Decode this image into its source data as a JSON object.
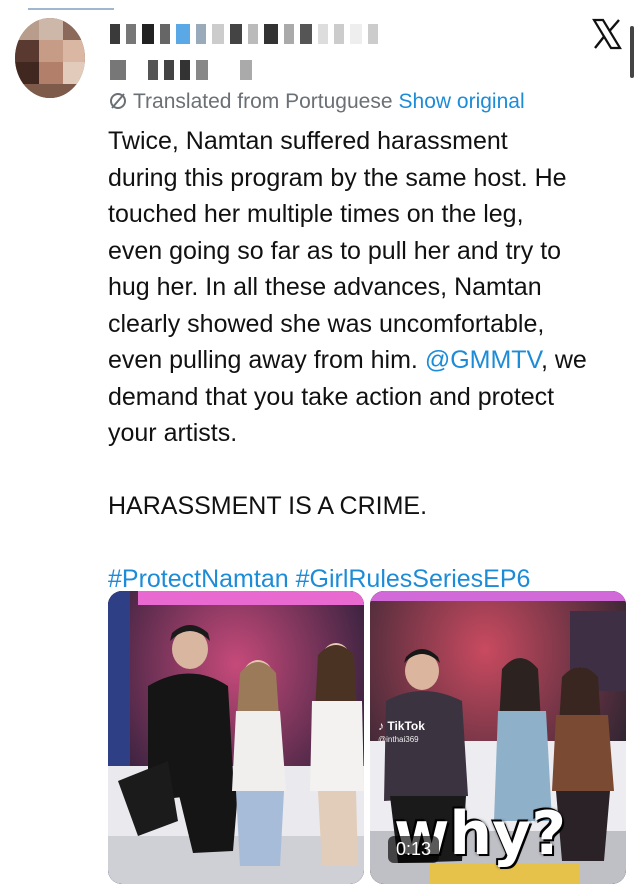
{
  "header": {
    "close_icon": "x-logo-icon"
  },
  "tweet": {
    "translation_note": "Translated from Portuguese",
    "show_original": "Show original",
    "lines": [
      "Twice, Namtan suffered harassment",
      "during this program by the same host. He",
      "touched her multiple times on the leg,",
      "even going so far as to pull her and try to",
      "hug her. In all these advances, Namtan",
      "clearly showed she was uncomfortable,"
    ],
    "line7_before": "even pulling away from him. ",
    "mention": "@GMMTV",
    "line7_after": ", we",
    "line8": "demand that you take action and protect",
    "line9": "your artists.",
    "shout": "HARASSMENT IS A CRIME.",
    "hashtag1": "#ProtectNamtan",
    "hashtag2": "#GirlRulesSeriesEP6"
  },
  "media": {
    "tiktok_label": "TikTok",
    "tiktok_user": "@inthai369",
    "caption": "why?",
    "duration": "0:13"
  },
  "colors": {
    "link": "#1d8cd8",
    "muted": "#6b7075"
  }
}
